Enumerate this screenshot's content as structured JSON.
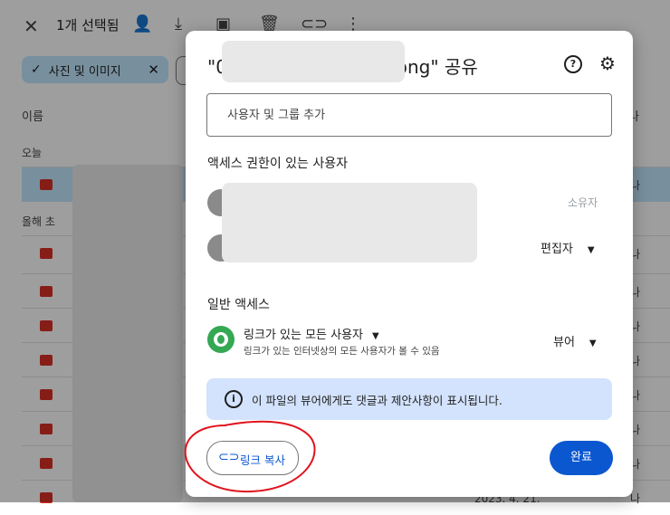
{
  "toolbar": {
    "close_icon": "close-icon",
    "selection_count": "1개 선택됨",
    "icons": [
      "add-person-icon",
      "download-icon",
      "move-to-folder-icon",
      "trash-icon",
      "link-icon",
      "more-vert-icon"
    ]
  },
  "filter_chip": {
    "label": "사진 및 이미지"
  },
  "list": {
    "column_name": "이름",
    "column_right": "나",
    "section_today": "오늘",
    "section_this_year": "올해 초",
    "row_owner": "나",
    "date_snippet": "2023. 4. 21."
  },
  "dialog": {
    "title_prefix": "\"0",
    "title_suffix": ".png\" 공유",
    "add_placeholder": "사용자 및 그룹 추가",
    "people_heading": "액세스 권한이 있는 사용자",
    "owner_role": "소유자",
    "editor_role": "편집자",
    "general_heading": "일반 액세스",
    "general_title": "링크가 있는 모든 사용자",
    "general_desc": "링크가 있는 인터넷상의 모든 사용자가 볼 수 있음",
    "general_role": "뷰어",
    "info_text": "이 파일의 뷰어에게도 댓글과 제안사항이 표시됩니다.",
    "copy_link": "링크 복사",
    "done": "완료"
  },
  "colors": {
    "accent": "#0b57d0",
    "info_bg": "#d3e3fd",
    "chip_bg": "#c2e7ff",
    "annotation": "#e0141e"
  }
}
